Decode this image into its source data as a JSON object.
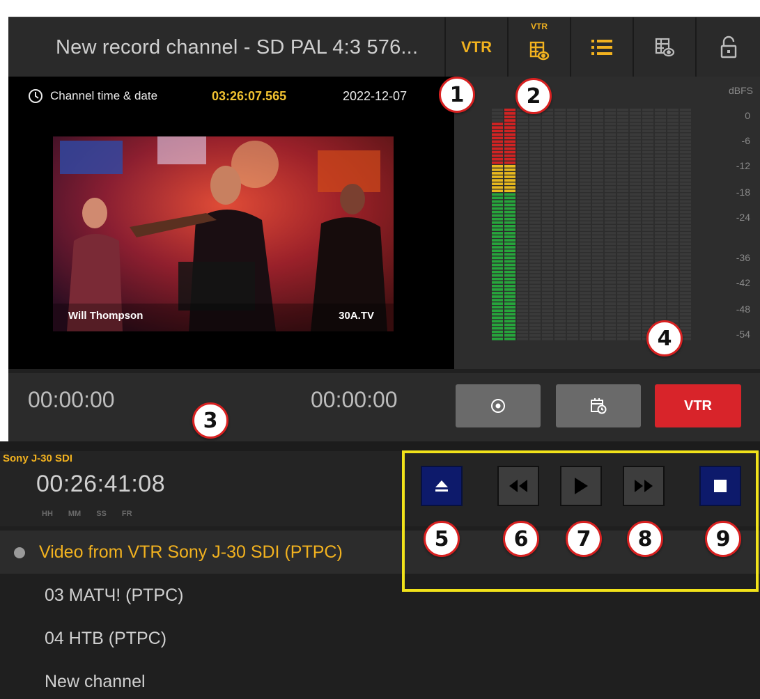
{
  "header": {
    "title": "New record channel - SD PAL 4:3 576...",
    "vtr_label": "VTR",
    "vtr_mini_label": "VTR",
    "icons": [
      "vtr-grid-eye-icon",
      "list-icon",
      "grid-eye-icon",
      "lock-icon"
    ]
  },
  "preview": {
    "clock_label": "Channel time & date",
    "time": "03:26:07.565",
    "date": "2022-12-07",
    "caption_left": "Will Thompson",
    "caption_right": "30A.TV"
  },
  "meter": {
    "unit": "dBFS",
    "ticks": [
      "0",
      "-6",
      "-12",
      "-18",
      "-24",
      "-36",
      "-42",
      "-48",
      "-54"
    ],
    "colors": {
      "red": "#d22323",
      "yellow": "#e8b91e",
      "green": "#27a63c"
    }
  },
  "timecode": {
    "left": "00:00:00",
    "right": "00:00:00",
    "vtr_button": "VTR"
  },
  "deck": {
    "name": "Sony J-30 SDI",
    "timecode": "00:26:41:08",
    "units": [
      "HH",
      "MM",
      "SS",
      "FR"
    ]
  },
  "channels": [
    {
      "label": "Video from VTR Sony J-30 SDI (PTPC)"
    },
    {
      "label": "03 МАТЧ! (PTPC)"
    },
    {
      "label": "04 НТВ (PTPC)"
    },
    {
      "label": "New channel"
    }
  ],
  "badges": [
    "1",
    "2",
    "3",
    "4",
    "5",
    "6",
    "7",
    "8",
    "9"
  ],
  "colors": {
    "accent": "#f2b21f",
    "record_red": "#d8242a",
    "highlight": "#f1e21a",
    "transport_blue": "#0d1a6b"
  }
}
